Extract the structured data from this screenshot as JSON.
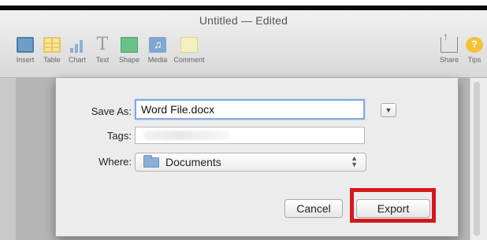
{
  "window": {
    "title": "Untitled — Edited"
  },
  "toolbar": {
    "left_items": [
      {
        "label": "Insert",
        "icon": "insert-icon"
      },
      {
        "label": "Table",
        "icon": "table-icon"
      },
      {
        "label": "Chart",
        "icon": "chart-icon"
      },
      {
        "label": "Text",
        "icon": "text-icon"
      },
      {
        "label": "Shape",
        "icon": "shape-icon"
      },
      {
        "label": "Media",
        "icon": "media-icon"
      },
      {
        "label": "Comment",
        "icon": "comment-icon"
      }
    ],
    "right_items": [
      {
        "label": "Share",
        "icon": "share-icon"
      },
      {
        "label": "Tips",
        "icon": "tips-icon"
      }
    ]
  },
  "save_dialog": {
    "save_as_label": "Save As:",
    "save_as_value": "Word File.docx",
    "tags_label": "Tags:",
    "tags_value": "",
    "where_label": "Where:",
    "where_value": "Documents",
    "cancel_label": "Cancel",
    "export_label": "Export"
  },
  "colors": {
    "highlight": "#d6171b",
    "focus_ring": "#7fa9e0",
    "folder": "#8ab0d8"
  }
}
